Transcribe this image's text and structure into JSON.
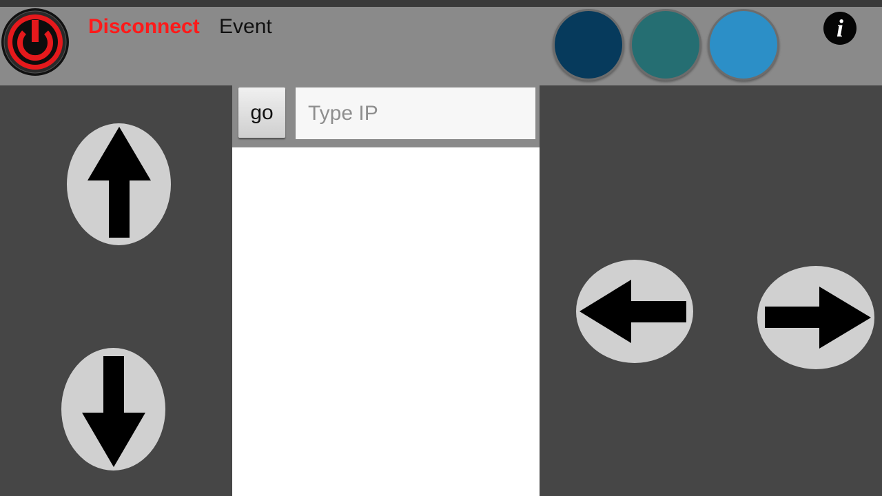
{
  "header": {
    "disconnect_label": "Disconnect",
    "event_label": "Event",
    "info_label": "i"
  },
  "connection": {
    "go_label": "go",
    "ip_placeholder": "Type IP",
    "ip_value": ""
  },
  "color_buttons": [
    {
      "name": "dark-blue",
      "color": "#063a5c"
    },
    {
      "name": "teal",
      "color": "#256e72"
    },
    {
      "name": "light-blue",
      "color": "#2c8fc7"
    }
  ],
  "icons": {
    "power": "power-icon",
    "info": "info-icon",
    "up": "arrow-up-icon",
    "down": "arrow-down-icon",
    "left": "arrow-left-icon",
    "right": "arrow-right-icon"
  },
  "colors": {
    "power_accent": "#e5191c",
    "disconnect_text": "#ff1a1a",
    "topbar_bg": "#8a8a8a",
    "panel_bg": "#464646",
    "arrow_button_bg": "#d0d0d0"
  }
}
